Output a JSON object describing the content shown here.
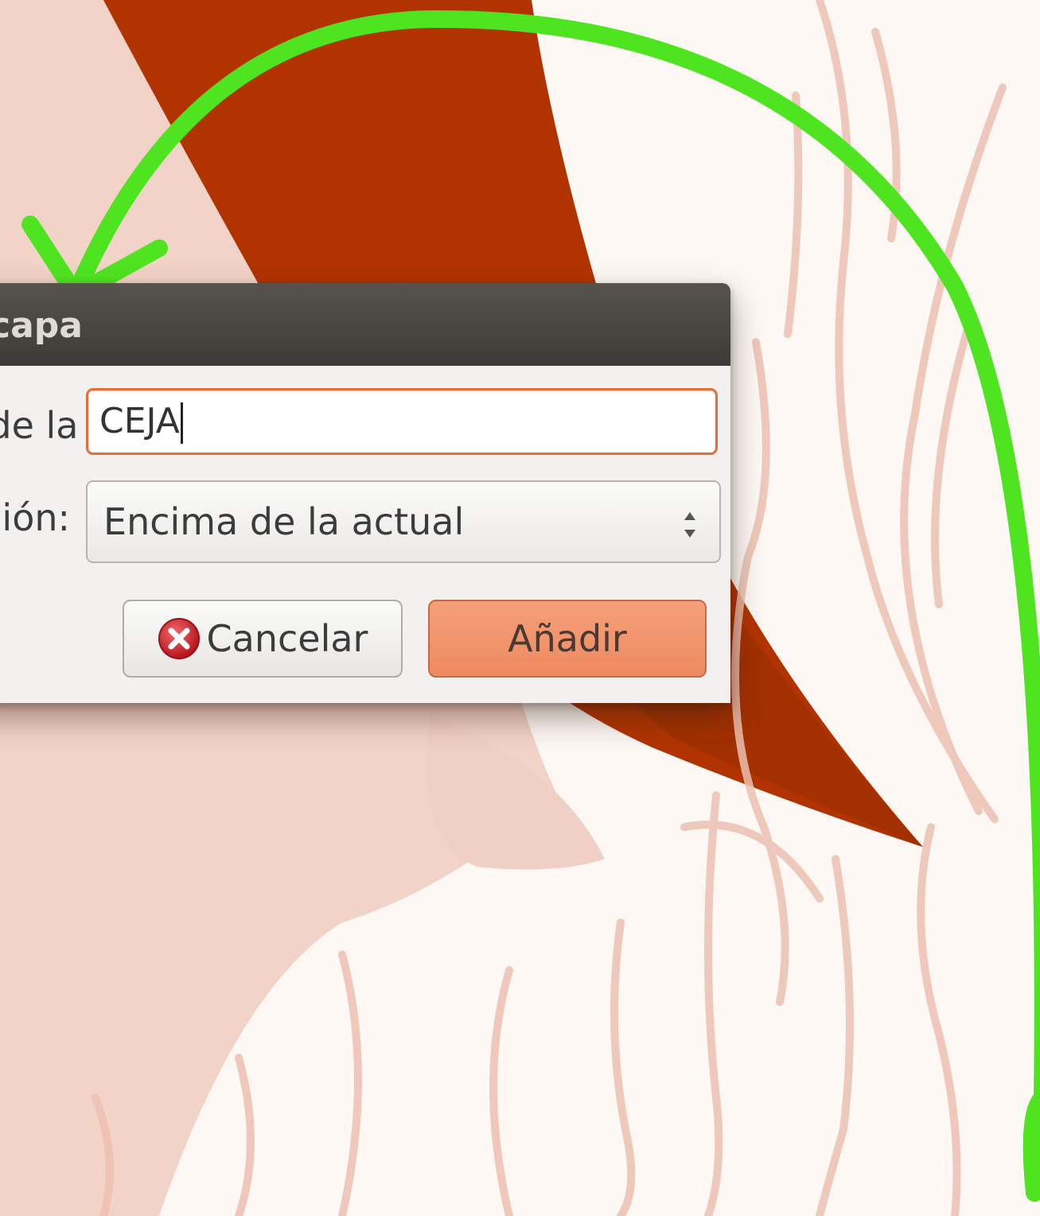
{
  "dialog": {
    "title": "Nueva capa",
    "name_label": "Nombre de la capa:",
    "name_value": "CEJA",
    "position_label": "Posición:",
    "position_value": "Encima de la actual",
    "cancel_label": "Cancelar",
    "add_label": "Añadir"
  },
  "icons": {
    "cancel": "cancel-circle-icon",
    "spinner": "updown-spinner-icon",
    "annotation": "green-curved-arrow"
  },
  "colors": {
    "accent": "#e0703a",
    "add_button": "#ee8a60",
    "annotation": "#4ee520",
    "titlebar": "#3c3b37"
  }
}
